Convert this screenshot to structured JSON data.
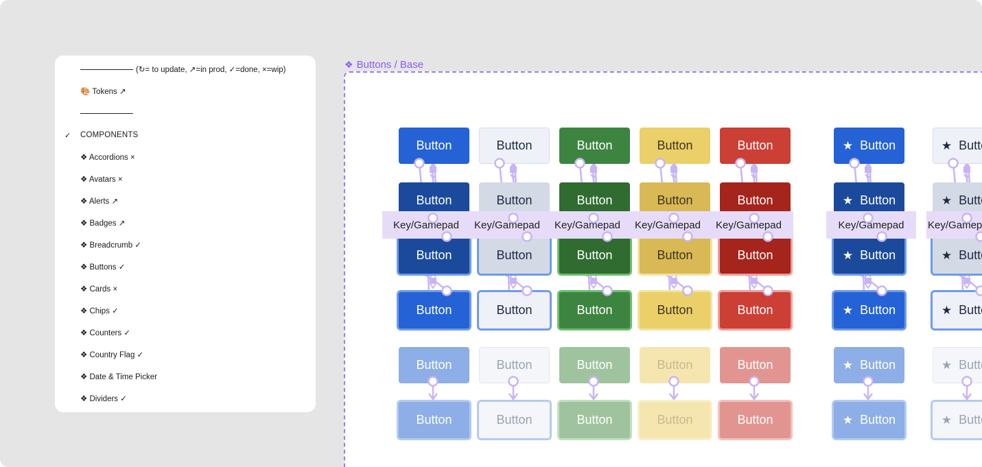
{
  "layers": [
    {
      "id": "legend",
      "check": "",
      "prefix_rule": true,
      "label": "(↻= to update, ↗=in prod, ✓=done, ×=wip)"
    },
    {
      "id": "tokens",
      "check": "",
      "prefix_rule": false,
      "label": "🎨  Tokens ↗"
    },
    {
      "id": "divider",
      "check": "",
      "prefix_rule": true,
      "label": ""
    },
    {
      "id": "components",
      "check": "✓",
      "prefix_rule": false,
      "label": "COMPONENTS"
    },
    {
      "id": "accordions",
      "check": "",
      "prefix_rule": false,
      "label": "❖ Accordions ×"
    },
    {
      "id": "avatars",
      "check": "",
      "prefix_rule": false,
      "label": "❖ Avatars ×"
    },
    {
      "id": "alerts",
      "check": "",
      "prefix_rule": false,
      "label": "❖ Alerts ↗"
    },
    {
      "id": "badges",
      "check": "",
      "prefix_rule": false,
      "label": "❖ Badges ↗"
    },
    {
      "id": "breadcrumb",
      "check": "",
      "prefix_rule": false,
      "label": "❖ Breadcrumb ✓"
    },
    {
      "id": "buttons",
      "check": "",
      "prefix_rule": false,
      "label": "❖ Buttons ✓"
    },
    {
      "id": "cards",
      "check": "",
      "prefix_rule": false,
      "label": "❖ Cards ×"
    },
    {
      "id": "chips",
      "check": "",
      "prefix_rule": false,
      "label": "❖ Chips ✓"
    },
    {
      "id": "counters",
      "check": "",
      "prefix_rule": false,
      "label": "❖ Counters ✓"
    },
    {
      "id": "country-flag",
      "check": "",
      "prefix_rule": false,
      "label": "❖ Country Flag ✓"
    },
    {
      "id": "date-time-picker",
      "check": "",
      "prefix_rule": false,
      "label": "❖ Date & Time Picker"
    },
    {
      "id": "dividers",
      "check": "",
      "prefix_rule": false,
      "label": "❖ Dividers ✓"
    }
  ],
  "frame": {
    "icon": "❖",
    "title": "Buttons / Base"
  },
  "button_label": "Button",
  "star_icon": "★",
  "key_label": "Key/Gamepad",
  "variants": [
    {
      "name": "primary",
      "star": false,
      "states": [
        {
          "bg": "#2462d6",
          "fg": "#ffffff",
          "border": ""
        },
        {
          "bg": "#1b4a9c",
          "fg": "#ffffff",
          "border": ""
        },
        {
          "bg": "#1b4a9c",
          "fg": "#ffffff",
          "border": "#6f9bea"
        },
        {
          "bg": "#2462d6",
          "fg": "#ffffff",
          "border": "#6f9bea"
        },
        {
          "bg": "#8daee6",
          "fg": "#ffffff",
          "border": ""
        },
        {
          "bg": "#8daee6",
          "fg": "#ffffff",
          "border": "#b4cbf0"
        }
      ]
    },
    {
      "name": "secondary",
      "star": false,
      "states": [
        {
          "bg": "#eef1f8",
          "fg": "#1f2940",
          "border": "#d6dcea"
        },
        {
          "bg": "#d3dae6",
          "fg": "#1f2940",
          "border": ""
        },
        {
          "bg": "#d3dae6",
          "fg": "#1f2940",
          "border": "#6f9bea"
        },
        {
          "bg": "#eef1f8",
          "fg": "#1f2940",
          "border": "#6f9bea"
        },
        {
          "bg": "#f4f6fa",
          "fg": "#9aa3b5",
          "border": "#e3e7ee"
        },
        {
          "bg": "#f4f6fa",
          "fg": "#9aa3b5",
          "border": "#b4cbf0"
        }
      ]
    },
    {
      "name": "success",
      "star": false,
      "states": [
        {
          "bg": "#3e8441",
          "fg": "#ffffff",
          "border": ""
        },
        {
          "bg": "#306b30",
          "fg": "#ffffff",
          "border": ""
        },
        {
          "bg": "#306b30",
          "fg": "#ffffff",
          "border": "#6dbf6d"
        },
        {
          "bg": "#3e8441",
          "fg": "#ffffff",
          "border": "#6dbf6d"
        },
        {
          "bg": "#9fc39f",
          "fg": "#ffffff",
          "border": ""
        },
        {
          "bg": "#9fc39f",
          "fg": "#ffffff",
          "border": "#c3dfc3"
        }
      ]
    },
    {
      "name": "warning",
      "star": false,
      "states": [
        {
          "bg": "#ebcf68",
          "fg": "#3d3520",
          "border": ""
        },
        {
          "bg": "#d9b955",
          "fg": "#3d3520",
          "border": ""
        },
        {
          "bg": "#d9b955",
          "fg": "#3d3520",
          "border": "#f3e3a3"
        },
        {
          "bg": "#ebcf68",
          "fg": "#3d3520",
          "border": "#f3e3a3"
        },
        {
          "bg": "#f5e6b0",
          "fg": "#c7bb8c",
          "border": ""
        },
        {
          "bg": "#f5e6b0",
          "fg": "#c7bb8c",
          "border": "#f8efcc"
        }
      ]
    },
    {
      "name": "danger",
      "star": false,
      "states": [
        {
          "bg": "#cb3f35",
          "fg": "#ffffff",
          "border": ""
        },
        {
          "bg": "#a5241c",
          "fg": "#ffffff",
          "border": ""
        },
        {
          "bg": "#a5241c",
          "fg": "#ffffff",
          "border": "#f19d97"
        },
        {
          "bg": "#cb3f35",
          "fg": "#ffffff",
          "border": "#f19d97"
        },
        {
          "bg": "#e29590",
          "fg": "#ffffff",
          "border": ""
        },
        {
          "bg": "#e29590",
          "fg": "#ffffff",
          "border": "#f2c2bf"
        }
      ]
    },
    {
      "name": "primary-icon",
      "star": true,
      "states": [
        {
          "bg": "#2462d6",
          "fg": "#ffffff",
          "border": ""
        },
        {
          "bg": "#1b4a9c",
          "fg": "#ffffff",
          "border": ""
        },
        {
          "bg": "#1b4a9c",
          "fg": "#ffffff",
          "border": "#6f9bea"
        },
        {
          "bg": "#2462d6",
          "fg": "#ffffff",
          "border": "#6f9bea"
        },
        {
          "bg": "#8daee6",
          "fg": "#ffffff",
          "border": ""
        },
        {
          "bg": "#8daee6",
          "fg": "#ffffff",
          "border": "#b4cbf0"
        }
      ]
    },
    {
      "name": "secondary-icon",
      "star": true,
      "states": [
        {
          "bg": "#eef1f8",
          "fg": "#1f2940",
          "border": "#d6dcea"
        },
        {
          "bg": "#d3dae6",
          "fg": "#1f2940",
          "border": ""
        },
        {
          "bg": "#d3dae6",
          "fg": "#1f2940",
          "border": "#6f9bea"
        },
        {
          "bg": "#eef1f8",
          "fg": "#1f2940",
          "border": "#6f9bea"
        },
        {
          "bg": "#f4f6fa",
          "fg": "#9aa3b5",
          "border": "#e3e7ee"
        },
        {
          "bg": "#f4f6fa",
          "fg": "#9aa3b5",
          "border": "#b4cbf0"
        }
      ]
    }
  ],
  "colors": {
    "frame_accent": "#8b5cf6",
    "prototype_line": "#c8b4f5",
    "key_label_bg": "#e6dcfa"
  }
}
